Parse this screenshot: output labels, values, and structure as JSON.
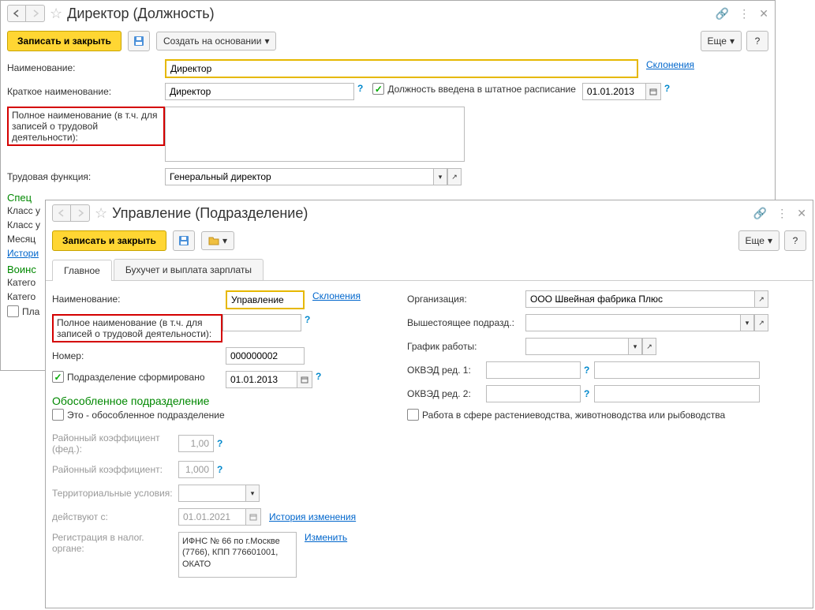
{
  "win1": {
    "title": "Директор (Должность)",
    "toolbar": {
      "save_close": "Записать и закрыть",
      "create_based": "Создать на основании",
      "more": "Еще",
      "help": "?"
    },
    "labels": {
      "name": "Наименование:",
      "short_name": "Краткое наименование:",
      "full_name": "Полное наименование (в т.ч. для записей о трудовой деятельности):",
      "labor_func": "Трудовая функция:",
      "in_schedule": "Должность введена в штатное расписание",
      "declension": "Склонения"
    },
    "values": {
      "name": "Директор",
      "short_name": "Директор",
      "full_name": "",
      "labor_func": "Генеральный директор",
      "schedule_date": "01.01.2013"
    },
    "sections": {
      "spec": "Спец",
      "class_u1": "Класс у",
      "class_u2": "Класс у",
      "month": "Месяц",
      "history": "Истори",
      "military": "Воинс",
      "category1": "Катего",
      "category2": "Катего",
      "pla": "Пла"
    }
  },
  "win2": {
    "title": "Управление (Подразделение)",
    "toolbar": {
      "save_close": "Записать и закрыть",
      "more": "Еще",
      "help": "?"
    },
    "tabs": {
      "main": "Главное",
      "accounting": "Бухучет и выплата зарплаты"
    },
    "labels": {
      "name": "Наименование:",
      "full_name": "Полное наименование (в т.ч. для записей о трудовой деятельности):",
      "number": "Номер:",
      "formed": "Подразделение сформировано",
      "separate_head": "Обособленное подразделение",
      "is_separate": "Это - обособленное подразделение",
      "district_fed": "Районный коэффициент (фед.):",
      "district": "Районный коэффициент:",
      "territorial": "Территориальные условия:",
      "effective_from": "действуют с:",
      "tax_reg": "Регистрация в налог. органе:",
      "history_link": "История изменения",
      "change_link": "Изменить",
      "declension": "Склонения",
      "org": "Организация:",
      "parent": "Вышестоящее подразд.:",
      "schedule": "График работы:",
      "okved1": "ОКВЭД ред. 1:",
      "okved2": "ОКВЭД ред. 2:",
      "agriculture": "Работа в сфере растениеводства, животноводства или рыбоводства"
    },
    "values": {
      "name": "Управление",
      "full_name": "",
      "number": "000000002",
      "formed_date": "01.01.2013",
      "district_fed": "1,00",
      "district": "1,000",
      "territorial": "",
      "effective_from": "01.01.2021",
      "tax_reg": "ИФНС № 66 по г.Москве (7766), КПП 776601001, ОКАТО",
      "org": "ООО Швейная фабрика Плюс",
      "parent": "",
      "schedule": "",
      "okved1": "",
      "okved2": ""
    }
  }
}
